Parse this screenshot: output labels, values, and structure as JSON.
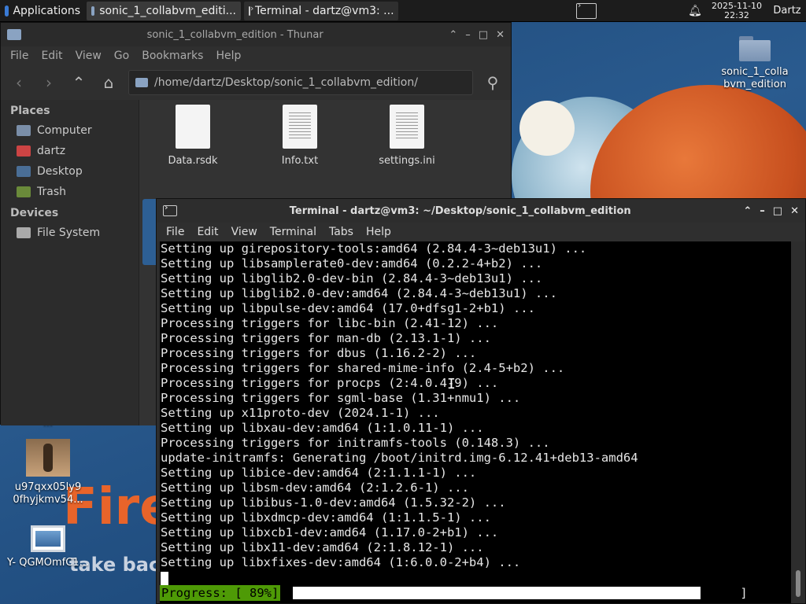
{
  "panel": {
    "applications_label": "Applications",
    "tasks": [
      {
        "label": "sonic_1_collabvm_editi..."
      },
      {
        "label": "Terminal - dartz@vm3: ..."
      }
    ],
    "clock_date": "2025-11-10",
    "clock_time": "22:32",
    "user": "Dartz"
  },
  "desktop": {
    "icons": [
      {
        "label": "sonic_1_colla bvm_edition"
      },
      {
        "label": "u97qxx05ly9 0fhyjkmv54..."
      },
      {
        "label": "Y- QGMOmfC1..."
      },
      {
        "label": "..."
      }
    ],
    "wallpaper_text_1": "Fire",
    "wallpaper_text_2": "take back"
  },
  "thunar": {
    "title": "sonic_1_collabvm_edition - Thunar",
    "menu": [
      "File",
      "Edit",
      "View",
      "Go",
      "Bookmarks",
      "Help"
    ],
    "path": "/home/dartz/Desktop/sonic_1_collabvm_edition/",
    "places_heading": "Places",
    "places": [
      "Computer",
      "dartz",
      "Desktop",
      "Trash"
    ],
    "devices_heading": "Devices",
    "devices": [
      "File System"
    ],
    "files": [
      "Data.rsdk",
      "Info.txt",
      "settings.ini"
    ]
  },
  "terminal": {
    "title": "Terminal - dartz@vm3: ~/Desktop/sonic_1_collabvm_edition",
    "menu": [
      "File",
      "Edit",
      "View",
      "Terminal",
      "Tabs",
      "Help"
    ],
    "lines": [
      "Setting up girepository-tools:amd64 (2.84.4-3~deb13u1) ...",
      "Setting up libsamplerate0-dev:amd64 (0.2.2-4+b2) ...",
      "Setting up libglib2.0-dev-bin (2.84.4-3~deb13u1) ...",
      "Setting up libglib2.0-dev:amd64 (2.84.4-3~deb13u1) ...",
      "Setting up libpulse-dev:amd64 (17.0+dfsg1-2+b1) ...",
      "Processing triggers for libc-bin (2.41-12) ...",
      "Processing triggers for man-db (2.13.1-1) ...",
      "Processing triggers for dbus (1.16.2-2) ...",
      "Processing triggers for shared-mime-info (2.4-5+b2) ...",
      "Processing triggers for procps (2:4.0.4-9) ...",
      "Processing triggers for sgml-base (1.31+nmu1) ...",
      "Setting up x11proto-dev (2024.1-1) ...",
      "Setting up libxau-dev:amd64 (1:1.0.11-1) ...",
      "Processing triggers for initramfs-tools (0.148.3) ...",
      "update-initramfs: Generating /boot/initrd.img-6.12.41+deb13-amd64",
      "Setting up libice-dev:amd64 (2:1.1.1-1) ...",
      "Setting up libsm-dev:amd64 (2:1.2.6-1) ...",
      "Setting up libibus-1.0-dev:amd64 (1.5.32-2) ...",
      "Setting up libxdmcp-dev:amd64 (1:1.1.5-1) ...",
      "Setting up libxcb1-dev:amd64 (1.17.0-2+b1) ...",
      "Setting up libx11-dev:amd64 (2:1.8.12-1) ...",
      "Setting up libxfixes-dev:amd64 (1:6.0.0-2+b4) ..."
    ],
    "progress_label": "Progress: [ 89%]",
    "progress_fraction": 0.89,
    "bracket_open": "[",
    "bracket_close": "]"
  }
}
